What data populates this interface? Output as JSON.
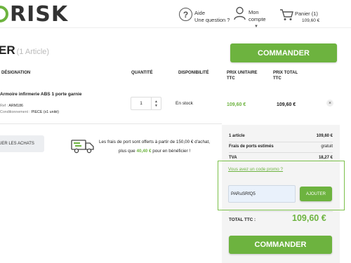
{
  "header": {
    "logo_text": "RISK",
    "help_line1": "Aide",
    "help_line2": "Une question ?",
    "account_line1": "Mon",
    "account_line2": "compte",
    "cart_label": "Panier (1)",
    "cart_total": "109,60 €"
  },
  "page": {
    "title": "ER",
    "item_count": "(1 Article)",
    "commander_label": "COMMANDER"
  },
  "table": {
    "headers": {
      "designation": "DÉSIGNATION",
      "quantity": "QUANTITÉ",
      "availability": "DISPONIBILITÉ",
      "unit_price_1": "PRIX UNITAIRE",
      "unit_price_2": "TTC",
      "total_price_1": "PRIX TOTAL",
      "total_price_2": "TTC"
    },
    "rows": [
      {
        "name": "Armoire infirmerie ABS 1 porte garnie",
        "ref_label": "Ref :",
        "ref_value": "ARM186",
        "cond_label": "Conditionnement :",
        "cond_value": "PIECE (x1 unité)",
        "quantity": "1",
        "availability": "En stock",
        "unit_price": "109,60 €",
        "total_price": "109,60 €"
      }
    ]
  },
  "actions": {
    "continue_label": "UER LES ACHATS"
  },
  "shipping": {
    "line1": "Les frais de port sont offerts à partir de 150,00 € d'achat,",
    "line2_pre": "plus que",
    "line2_amount": "40,40 €",
    "line2_post": "pour en bénéficier !"
  },
  "summary": {
    "articles_label": "1 article",
    "articles_value": "109,60 €",
    "shipping_label": "Frais de ports estimés",
    "shipping_value": "gratuit",
    "tva_label": "TVA",
    "tva_value": "18,27 €",
    "promo_link": "Vous avez un code promo ?",
    "promo_value": "PARuSRfQ5",
    "add_label": "AJOUTER",
    "total_label": "TOTAL TTC :",
    "total_value": "109,60 €",
    "commander_label": "COMMANDER"
  },
  "colors": {
    "brand_green": "#6db33f",
    "summary_bg": "#f4f4f4",
    "input_bg": "#e9f1fb"
  },
  "icons": [
    "help-icon",
    "account-icon",
    "cart-icon",
    "truck-icon",
    "remove-icon"
  ]
}
